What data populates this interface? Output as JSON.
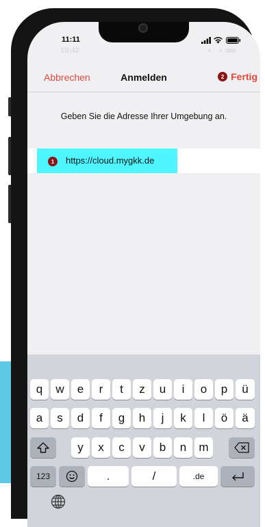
{
  "status": {
    "time": "11:11",
    "ghost_time": "10:42"
  },
  "nav": {
    "cancel": "Abbrechen",
    "title": "Anmelden",
    "done_badge": "2",
    "done": "Fertig"
  },
  "instruction": "Geben Sie die Adresse Ihrer Umgebung an.",
  "url_field": {
    "badge": "1",
    "value": "https://cloud.mygkk.de"
  },
  "keyboard": {
    "row1": [
      "q",
      "w",
      "e",
      "r",
      "t",
      "z",
      "u",
      "i",
      "o",
      "p",
      "ü"
    ],
    "row2": [
      "a",
      "s",
      "d",
      "f",
      "g",
      "h",
      "j",
      "k",
      "l",
      "ö",
      "ä"
    ],
    "row3": [
      "y",
      "x",
      "c",
      "v",
      "b",
      "n",
      "m"
    ],
    "numbers": "123",
    "dot": ".",
    "slash": "/",
    "de": ".de"
  },
  "colors": {
    "accent": "#e0483a",
    "badge": "#8b1515",
    "highlight": "#4ef6ff",
    "side_bar": "#5bc8e4"
  },
  "icons": [
    "signal-icon",
    "wifi-icon",
    "battery-icon",
    "shift-icon",
    "backspace-icon",
    "emoji-icon",
    "return-icon",
    "globe-icon"
  ]
}
